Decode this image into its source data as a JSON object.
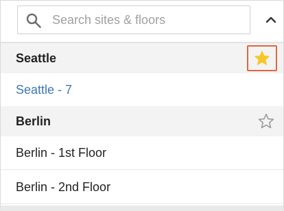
{
  "search": {
    "placeholder": "Search sites & floors",
    "value": ""
  },
  "groups": [
    {
      "site": "Seattle",
      "favorite": true,
      "floors": [
        "Seattle - 7"
      ]
    },
    {
      "site": "Berlin",
      "favorite": false,
      "floors": [
        "Berlin - 1st Floor",
        "Berlin - 2nd Floor"
      ]
    }
  ],
  "colors": {
    "star_filled": "#f7c728",
    "star_outline": "#9a9a9a",
    "highlight_border": "#e0663c",
    "active_floor_text": "#3a78b5"
  },
  "icons": {
    "search": "magnifier-icon",
    "collapse": "chevron-up-icon",
    "favorite_on": "star-filled-icon",
    "favorite_off": "star-outline-icon"
  }
}
